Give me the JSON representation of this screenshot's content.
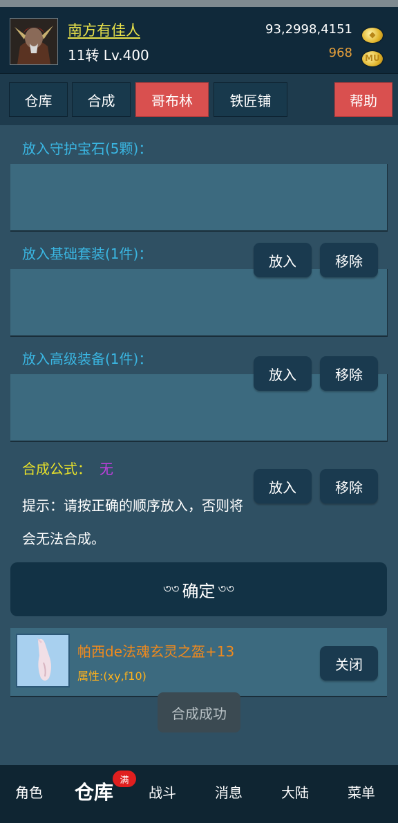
{
  "header": {
    "player_name": "南方有佳人",
    "player_level": "11转 Lv.400",
    "gold": "93,2998,4151",
    "gold_icon": "gold-coin-icon",
    "mu": "968",
    "mu_icon_label": "MU",
    "colors": {
      "name": "#e9e24a",
      "mu": "#e7a03a",
      "accent_red": "#d9504f"
    }
  },
  "tabs": [
    {
      "label": "仓库"
    },
    {
      "label": "合成"
    },
    {
      "label": "哥布林",
      "active": true
    },
    {
      "label": "铁匠铺"
    }
  ],
  "help_label": "帮助",
  "sections": {
    "guard_gem_label": "放入守护宝石(5颗)：",
    "base_suit_label": "放入基础套装(1件)：",
    "advanced_equip_label": "放入高级装备(1件)："
  },
  "buttons": {
    "put_in": "放入",
    "remove": "移除",
    "close": "关闭"
  },
  "formula": {
    "label": "合成公式：",
    "value": "无"
  },
  "hint": "提示：请按正确的顺序放入，否则将会无法合成。",
  "confirm": {
    "label": "确定",
    "ornament_left": "৩৩",
    "ornament_right": "৩৩"
  },
  "result": {
    "item_name": "帕西de法魂玄灵之盔+13",
    "item_attr": "属性:(xy,f10)"
  },
  "toast": "合成成功",
  "bottom_nav": [
    {
      "label": "角色"
    },
    {
      "label": "仓库",
      "active": true,
      "badge": "满"
    },
    {
      "label": "战斗"
    },
    {
      "label": "消息"
    },
    {
      "label": "大陆"
    },
    {
      "label": "菜单"
    }
  ]
}
